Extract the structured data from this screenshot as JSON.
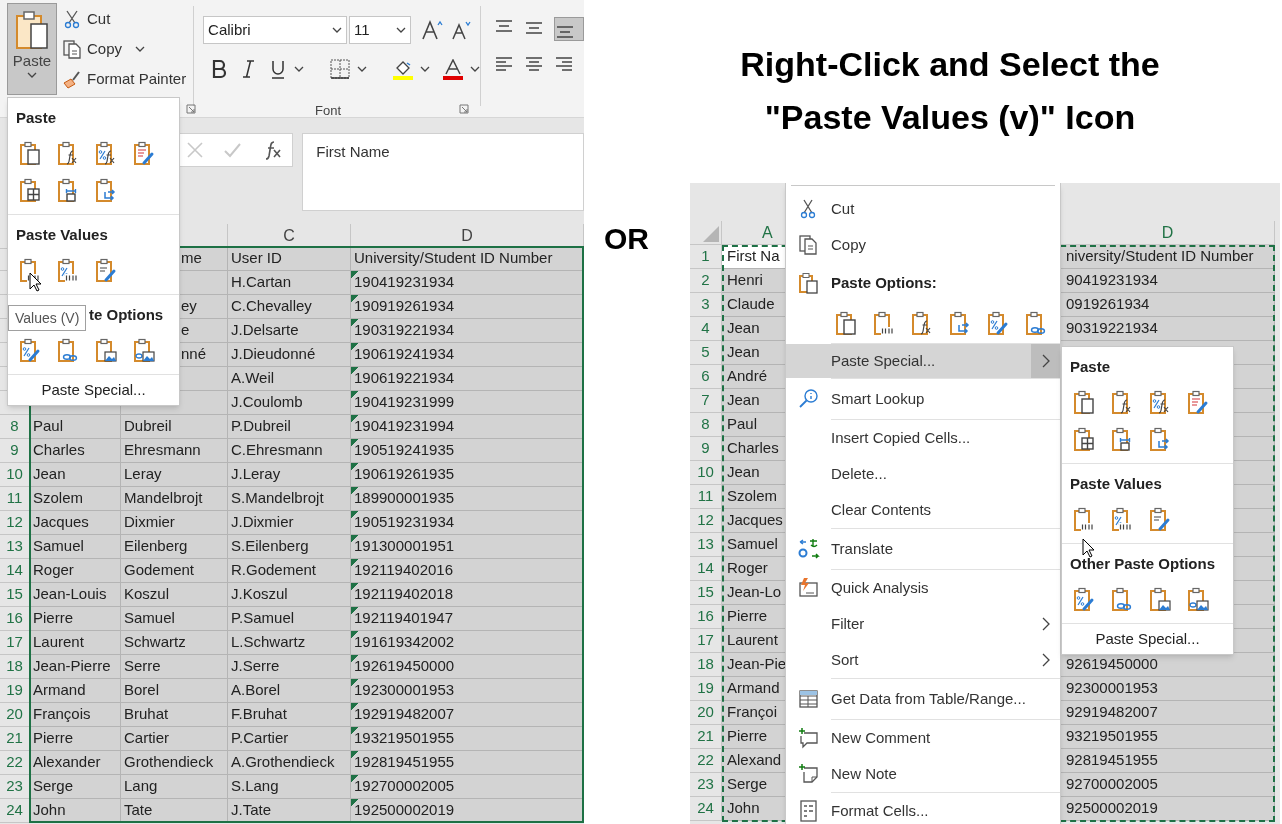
{
  "heading": {
    "lines": [
      "Right-Click and Select the",
      "\"Paste Values (v)\" Icon"
    ]
  },
  "or_label": "OR",
  "left_excel": {
    "ribbon": {
      "paste_label": "Paste",
      "paste_pressed": true,
      "cut": "Cut",
      "copy": "Copy",
      "format_painter": "Format Painter",
      "font_name": "Calibri",
      "font_size": "11",
      "font_group": "Font"
    },
    "formula_bar": {
      "value": "First Name"
    },
    "columns": [
      {},
      {},
      {
        "label": "C"
      },
      {
        "label": "D"
      }
    ],
    "rows": [
      {
        "b": "me",
        "covered_left": true,
        "c": "User ID",
        "d": "University/Student ID Number"
      },
      {
        "c": "H.Cartan",
        "d": "190419231934",
        "number_as_text": true
      },
      {
        "b": "ey",
        "covered_left": true,
        "c": "C.Chevalley",
        "d": "190919261934",
        "number_as_text": true
      },
      {
        "b": "e",
        "covered_left": true,
        "c": "J.Delsarte",
        "d": "190319221934",
        "number_as_text": true
      },
      {
        "b": "nné",
        "covered_left": true,
        "c": "J.Dieudonné",
        "d": "190619241934",
        "number_as_text": true
      },
      {
        "c": "A.Weil",
        "d": "190619221934",
        "number_as_text": true
      },
      {
        "c": "J.Coulomb",
        "d": "190419231999",
        "number_as_text": true
      },
      {
        "number": "8",
        "a": "Paul",
        "b": "Dubreil",
        "c": "P.Dubreil",
        "d": "190419231994",
        "number_as_text": true
      },
      {
        "number": "9",
        "a": "Charles",
        "b": "Ehresmann",
        "c": "C.Ehresmann",
        "d": "190519241935",
        "number_as_text": true
      },
      {
        "number": "10",
        "a": "Jean",
        "b": "Leray",
        "c": "J.Leray",
        "d": "190619261935",
        "number_as_text": true
      },
      {
        "number": "11",
        "a": "Szolem",
        "b": "Mandelbrojt",
        "c": "S.Mandelbrojt",
        "d": "189900001935",
        "number_as_text": true
      },
      {
        "number": "12",
        "a": "Jacques",
        "b": "Dixmier",
        "c": "J.Dixmier",
        "d": "190519231934",
        "number_as_text": true
      },
      {
        "number": "13",
        "a": "Samuel",
        "b": "Eilenberg",
        "c": "S.Eilenberg",
        "d": "191300001951",
        "number_as_text": true
      },
      {
        "number": "14",
        "a": "Roger",
        "b": "Godement",
        "c": "R.Godement",
        "d": "192119402016",
        "number_as_text": true
      },
      {
        "number": "15",
        "a": "Jean-Louis",
        "b": "Koszul",
        "c": "J.Koszul",
        "d": "192119402018",
        "number_as_text": true
      },
      {
        "number": "16",
        "a": "Pierre",
        "b": "Samuel",
        "c": "P.Samuel",
        "d": "192119401947",
        "number_as_text": true
      },
      {
        "number": "17",
        "a": "Laurent",
        "b": "Schwartz",
        "c": "L.Schwartz",
        "d": "191619342002",
        "number_as_text": true
      },
      {
        "number": "18",
        "a": "Jean-Pierre",
        "b": "Serre",
        "c": "J.Serre",
        "d": "192619450000",
        "number_as_text": true
      },
      {
        "number": "19",
        "a": "Armand",
        "b": "Borel",
        "c": "A.Borel",
        "d": "192300001953",
        "number_as_text": true
      },
      {
        "number": "20",
        "a": "François",
        "b": "Bruhat",
        "c": "F.Bruhat",
        "d": "192919482007",
        "number_as_text": true
      },
      {
        "number": "21",
        "a": "Pierre",
        "b": "Cartier",
        "c": "P.Cartier",
        "d": "193219501955",
        "number_as_text": true
      },
      {
        "number": "22",
        "a": "Alexander",
        "b": "Grothendieck",
        "c": "A.Grothendieck",
        "d": "192819451955",
        "number_as_text": true
      },
      {
        "number": "23",
        "a": "Serge",
        "b": "Lang",
        "c": "S.Lang",
        "d": "192700002005",
        "number_as_text": true
      },
      {
        "number": "24",
        "a": "John",
        "b": "Tate",
        "c": "J.Tate",
        "d": "192500002019",
        "number_as_text": true
      }
    ],
    "paste_menu": {
      "sections": [
        {
          "title": "Paste",
          "icons": [
            {
              "kind": "keep"
            },
            {
              "kind": "formulas"
            },
            {
              "kind": "formula_number"
            },
            {
              "kind": "source_formatting"
            },
            {
              "kind": "no_borders"
            },
            {
              "kind": "column_widths"
            },
            {
              "kind": "transpose"
            }
          ]
        },
        {
          "title": "Paste Values",
          "icons": [
            {
              "kind": "values"
            },
            {
              "kind": "values_number"
            },
            {
              "kind": "values_formatting"
            }
          ]
        },
        {
          "title": "te Options",
          "covered_left": true,
          "icons": [
            {
              "kind": "formatting"
            },
            {
              "kind": "link"
            },
            {
              "kind": "picture"
            },
            {
              "kind": "linked_picture"
            }
          ]
        }
      ],
      "footer": "Paste Special...",
      "tooltip": "Values (V)"
    }
  },
  "right_excel": {
    "columns": [
      {
        "label": "A"
      },
      {
        "label": "D"
      }
    ],
    "rows": [
      {
        "number": "1",
        "a": "First Na",
        "d": "niversity/Student ID Number",
        "active": true
      },
      {
        "number": "2",
        "a": "Henri",
        "d": "90419231934",
        "active": false
      },
      {
        "number": "3",
        "a": "Claude",
        "d": "0919261934",
        "active": false
      },
      {
        "number": "4",
        "a": "Jean",
        "d": "90319221934",
        "active": false
      },
      {
        "number": "5",
        "a": "Jean",
        "active": false
      },
      {
        "number": "6",
        "a": "André",
        "active": false
      },
      {
        "number": "7",
        "a": "Jean",
        "active": false
      },
      {
        "number": "8",
        "a": "Paul",
        "active": false
      },
      {
        "number": "9",
        "a": "Charles",
        "active": false
      },
      {
        "number": "10",
        "a": "Jean",
        "active": false
      },
      {
        "number": "11",
        "a": "Szolem",
        "active": false
      },
      {
        "number": "12",
        "a": "Jacques",
        "active": false
      },
      {
        "number": "13",
        "a": "Samuel",
        "active": false
      },
      {
        "number": "14",
        "a": "Roger",
        "active": false
      },
      {
        "number": "15",
        "a": "Jean-Lo",
        "active": false
      },
      {
        "number": "16",
        "a": "Pierre",
        "active": false
      },
      {
        "number": "17",
        "a": "Laurent",
        "active": false
      },
      {
        "number": "18",
        "a": "Jean-Pie",
        "d": "92619450000",
        "active": false
      },
      {
        "number": "19",
        "a": "Armand",
        "d": "92300001953",
        "active": false
      },
      {
        "number": "20",
        "a": "Françoi",
        "d": "92919482007",
        "active": false
      },
      {
        "number": "21",
        "a": "Pierre",
        "d": "93219501955",
        "active": false
      },
      {
        "number": "22",
        "a": "Alexand",
        "d": "92819451955",
        "active": false
      },
      {
        "number": "23",
        "a": "Serge",
        "d": "92700002005",
        "active": false
      },
      {
        "number": "24",
        "a": "John",
        "d": "92500002019",
        "active": false
      }
    ],
    "context_menu": [
      {
        "kind": "command",
        "label": "Cut",
        "selected": false
      },
      {
        "kind": "command",
        "label": "Copy",
        "selected": false
      },
      {
        "kind": "heading",
        "label": "Paste Options:"
      },
      {
        "kind": "icons",
        "icons": [
          {
            "kind": "keep"
          },
          {
            "kind": "values"
          },
          {
            "kind": "formulas"
          },
          {
            "kind": "transpose"
          },
          {
            "kind": "formatting"
          },
          {
            "kind": "link"
          }
        ]
      },
      {
        "kind": "command",
        "label": "Paste Special...",
        "selected": true,
        "has_submenu": true
      },
      {
        "kind": "command",
        "label": "Smart Lookup",
        "selected": false
      },
      {
        "kind": "command",
        "label": "Insert Copied Cells...",
        "selected": false
      },
      {
        "kind": "command",
        "label": "Delete...",
        "selected": false
      },
      {
        "kind": "command",
        "label": "Clear Contents",
        "selected": false
      },
      {
        "kind": "command",
        "label": "Translate",
        "selected": false
      },
      {
        "kind": "command",
        "label": "Quick Analysis",
        "selected": false
      },
      {
        "kind": "command",
        "label": "Filter",
        "selected": false,
        "has_submenu": true
      },
      {
        "kind": "command",
        "label": "Sort",
        "selected": false,
        "has_submenu": true
      },
      {
        "kind": "command",
        "label": "Get Data from Table/Range...",
        "selected": false
      },
      {
        "kind": "command",
        "label": "New Comment",
        "selected": false
      },
      {
        "kind": "command",
        "label": "New Note",
        "selected": false
      },
      {
        "kind": "command",
        "label": "Format Cells...",
        "selected": false
      }
    ],
    "submenu": {
      "sections": [
        {
          "title": "Paste",
          "icons": [
            {
              "kind": "keep"
            },
            {
              "kind": "formulas"
            },
            {
              "kind": "formula_number"
            },
            {
              "kind": "source_formatting"
            },
            {
              "kind": "no_borders"
            },
            {
              "kind": "column_widths"
            },
            {
              "kind": "transpose"
            }
          ]
        },
        {
          "title": "Paste Values",
          "icons": [
            {
              "kind": "values"
            },
            {
              "kind": "values_number"
            },
            {
              "kind": "values_formatting"
            }
          ]
        },
        {
          "title": "Other Paste Options",
          "icons": [
            {
              "kind": "formatting"
            },
            {
              "kind": "link"
            },
            {
              "kind": "picture"
            },
            {
              "kind": "linked_picture"
            }
          ]
        }
      ],
      "footer": "Paste Special..."
    }
  }
}
